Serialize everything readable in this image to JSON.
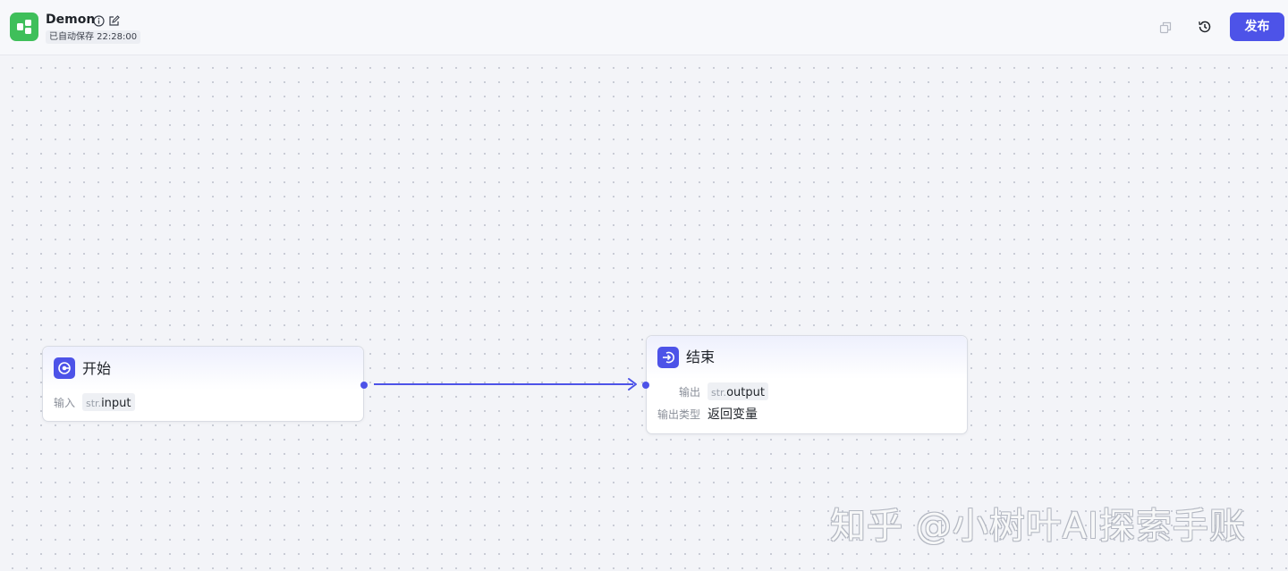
{
  "header": {
    "title": "Demon",
    "autosave": "已自动保存 22:28:00",
    "publish_label": "发布",
    "icons": [
      "workflow-logo-icon",
      "info-icon",
      "edit-icon",
      "copy-icon",
      "history-icon"
    ],
    "accent_color": "#4d53e8",
    "logo_color": "#3fbf5a"
  },
  "nodes": {
    "start": {
      "title": "开始",
      "input_label": "输入",
      "input_type": "str.",
      "input_name": "input"
    },
    "end": {
      "title": "结束",
      "output_label": "输出",
      "output_type": "str.",
      "output_name": "output",
      "output_kind_label": "输出类型",
      "output_kind_value": "返回变量"
    }
  },
  "watermark": "知乎 @小树叶AI探索手账"
}
